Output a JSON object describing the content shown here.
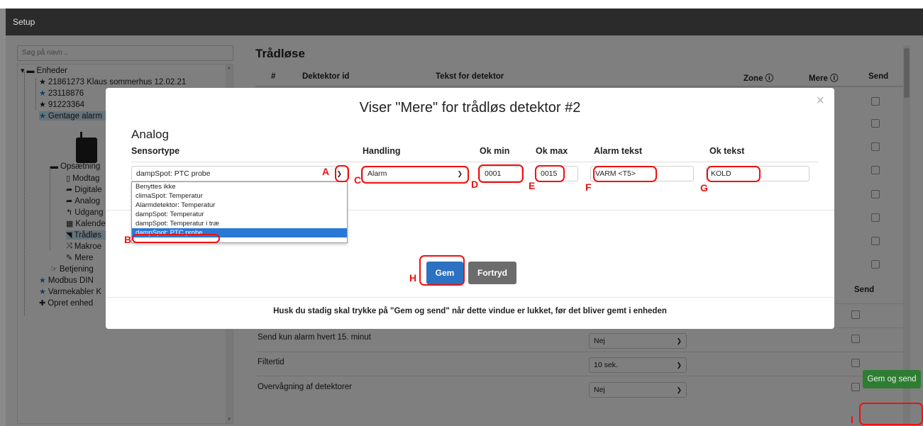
{
  "window": {
    "title": "Setup"
  },
  "sidebar": {
    "search_placeholder": "Søg på navn ..",
    "tree": {
      "root": "Enheder",
      "devices": [
        "21861273 Klaus sommerhus 12.02.21",
        "23118876",
        "91223364",
        "Gentage alarm"
      ],
      "config": "Opsætning",
      "config_items": [
        "Modtag",
        "Digitale",
        "Analog",
        "Udgang",
        "Kalende",
        "Trådløs",
        "Makroe",
        "Mere"
      ],
      "after": [
        "Betjening",
        "Modbus DIN",
        "Varmekabler K",
        "Opret enhed"
      ]
    }
  },
  "main": {
    "title": "Trådløse",
    "columns": {
      "num": "#",
      "id": "Dektektor id",
      "text": "Tekst for detektor",
      "zone": "Zone ⓘ",
      "more": "Mere ⓘ",
      "send": "Send"
    },
    "send_header2": "Send",
    "settings": [
      {
        "label": "Send kun alarm hvert 15. minut",
        "value": "Nej"
      },
      {
        "label": "Filtertid",
        "value": "10 sek."
      },
      {
        "label": "Overvågning af detektorer",
        "value": "Nej"
      }
    ],
    "gem_og_send": "Gem og send"
  },
  "modal": {
    "title": "Viser \"Mere\" for trådløs detektor #2",
    "section": "Analog",
    "headers": {
      "sensortype": "Sensortype",
      "handling": "Handling",
      "okmin": "Ok min",
      "okmax": "Ok max",
      "alarmtekst": "Alarm tekst",
      "oktekst": "Ok tekst"
    },
    "values": {
      "sensortype": "dampSpot: PTC probe",
      "handling": "Alarm",
      "okmin": "0001",
      "okmax": "0015",
      "alarmtekst": "VARM <T5>",
      "oktekst": "KOLD"
    },
    "dropdown_options": [
      "Benyttes ikke",
      "climaSpot: Temperatur",
      "Alarmdetektor: Temperatur",
      "dampSpot: Temperatur",
      "dampSpot: Temperatur i træ",
      "dampSpot: PTC probe"
    ],
    "buttons": {
      "save": "Gem",
      "cancel": "Fortryd"
    },
    "footer": "Husk du stadig skal trykke på \"Gem og send\" når dette vindue er lukket, før det bliver gemt i enheden"
  },
  "annotations": [
    "A",
    "B",
    "C",
    "D",
    "E",
    "F",
    "G",
    "H",
    "I"
  ],
  "colors": {
    "primary": "#2b72c2",
    "secondary": "#6c6c6c",
    "success": "#2e7d32",
    "annotation": "#e11111",
    "selection": "#2a78d6"
  }
}
